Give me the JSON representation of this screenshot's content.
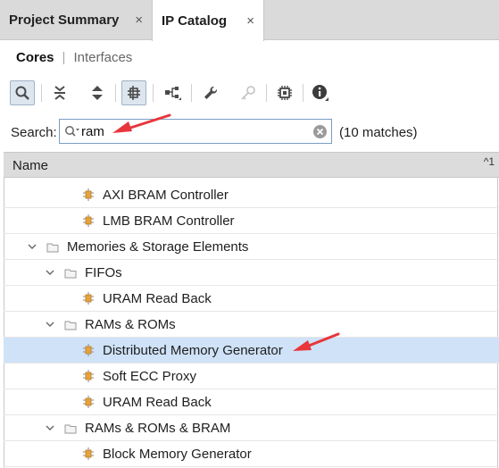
{
  "tabs": [
    {
      "label": "Project Summary",
      "close": "×"
    },
    {
      "label": "IP Catalog",
      "close": "×"
    }
  ],
  "subtabs": {
    "cores": "Cores",
    "separator": "|",
    "interfaces": "Interfaces"
  },
  "toolbar_icons": [
    "search-icon",
    "collapse-all-icon",
    "expand-all-icon",
    "filter-icon",
    "hierarchy-icon",
    "wrench-icon",
    "key-icon",
    "chip-icon",
    "info-icon"
  ],
  "search": {
    "label": "Search:",
    "value": "ram",
    "matches": "(10 matches)"
  },
  "table": {
    "column": "Name",
    "sort_indicator": "^1"
  },
  "tree": [
    {
      "label": "AXI BRAM Controller",
      "type": "core",
      "level": 2
    },
    {
      "label": "LMB BRAM Controller",
      "type": "core",
      "level": 2
    },
    {
      "label": "Memories & Storage Elements",
      "type": "folder",
      "level": 0
    },
    {
      "label": "FIFOs",
      "type": "folder",
      "level": 1
    },
    {
      "label": "URAM Read Back",
      "type": "core",
      "level": 2
    },
    {
      "label": "RAMs & ROMs",
      "type": "folder",
      "level": 1
    },
    {
      "label": "Distributed Memory Generator",
      "type": "core",
      "level": 2,
      "selected": true
    },
    {
      "label": "Soft ECC Proxy",
      "type": "core",
      "level": 2
    },
    {
      "label": "URAM Read Back",
      "type": "core",
      "level": 2
    },
    {
      "label": "RAMs & ROMs & BRAM",
      "type": "folder",
      "level": 1
    },
    {
      "label": "Block Memory Generator",
      "type": "core",
      "level": 2
    }
  ],
  "colors": {
    "selection": "#cfe2f7",
    "annotation_arrow": "#e8363b",
    "core_icon": "#e8a23a"
  }
}
